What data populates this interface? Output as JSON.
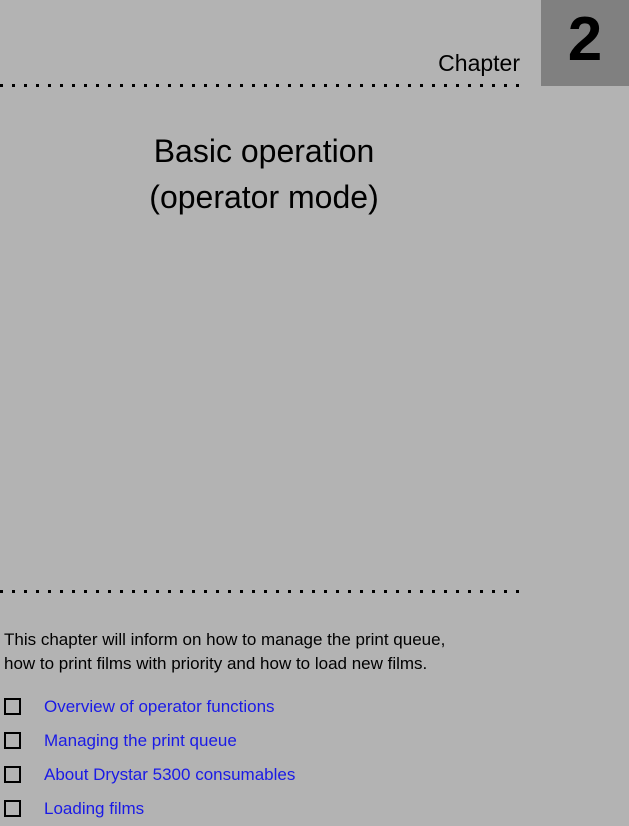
{
  "document": {
    "background_color": "#b3b3b3",
    "link_color": "#1a1ae6",
    "accent_block_color": "#808080"
  },
  "header": {
    "chapter_word": "Chapter",
    "chapter_number": "2"
  },
  "title": {
    "line1": "Basic operation",
    "line2": "(operator mode)"
  },
  "intro": {
    "line1": "This chapter will inform on how to manage the print queue,",
    "line2": "how to print films with priority and how to load new films."
  },
  "toc": {
    "items": [
      {
        "label": "Overview of operator functions"
      },
      {
        "label": "Managing the print queue"
      },
      {
        "label": "About Drystar 5300 consumables"
      },
      {
        "label": "Loading films"
      }
    ]
  }
}
